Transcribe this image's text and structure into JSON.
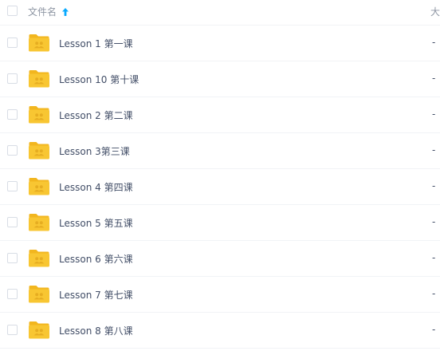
{
  "header": {
    "name_label": "文件名",
    "size_label": "大",
    "sort_icon": "arrow-up-icon"
  },
  "files": [
    {
      "name": "Lesson 1 第一课",
      "size": "-",
      "icon": "shared-folder-icon"
    },
    {
      "name": "Lesson 10 第十课",
      "size": "-",
      "icon": "shared-folder-icon"
    },
    {
      "name": "Lesson 2 第二课",
      "size": "-",
      "icon": "shared-folder-icon"
    },
    {
      "name": "Lesson 3第三课",
      "size": "-",
      "icon": "shared-folder-icon"
    },
    {
      "name": "Lesson 4 第四课",
      "size": "-",
      "icon": "shared-folder-icon"
    },
    {
      "name": "Lesson 5 第五课",
      "size": "-",
      "icon": "shared-folder-icon"
    },
    {
      "name": "Lesson 6 第六课",
      "size": "-",
      "icon": "shared-folder-icon"
    },
    {
      "name": "Lesson 7 第七课",
      "size": "-",
      "icon": "shared-folder-icon"
    },
    {
      "name": "Lesson 8 第八课",
      "size": "-",
      "icon": "shared-folder-icon"
    }
  ],
  "colors": {
    "folder": "#f8c632",
    "folder_back": "#f2b61f",
    "accent": "#09aaff",
    "text": "#424e67",
    "header_text": "#8e96a3"
  }
}
